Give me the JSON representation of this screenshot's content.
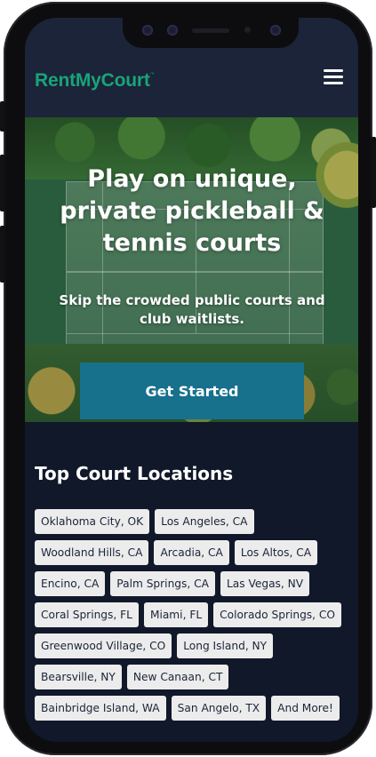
{
  "header": {
    "logo": "RentMyCourt",
    "logo_tm": "™",
    "menu_icon": "hamburger-menu-icon"
  },
  "hero": {
    "title": "Play on unique, private pickleball & tennis courts",
    "subtitle": "Skip the crowded public courts and club waitlists.",
    "cta_label": "Get Started"
  },
  "locations": {
    "title": "Top Court Locations",
    "rows": [
      [
        "Oklahoma City, OK",
        "Los Angeles, CA"
      ],
      [
        "Woodland Hills, CA",
        "Arcadia, CA",
        "Los Altos, CA"
      ],
      [
        "Encino, CA",
        "Palm Springs, CA",
        "Las Vegas, NV"
      ],
      [
        "Coral Springs, FL",
        "Miami, FL",
        "Colorado Springs, CO"
      ],
      [
        "Greenwood Village, CO",
        "Long Island, NY"
      ],
      [
        "Bearsville, NY",
        "New Canaan, CT"
      ],
      [
        "Bainbridge Island, WA",
        "San Angelo, TX",
        "And More!"
      ]
    ]
  },
  "colors": {
    "brand_green": "#1aa37a",
    "header_bg": "#1b2438",
    "page_bg": "#10182a",
    "cta_bg": "#17708c",
    "chip_bg": "#ececec"
  }
}
